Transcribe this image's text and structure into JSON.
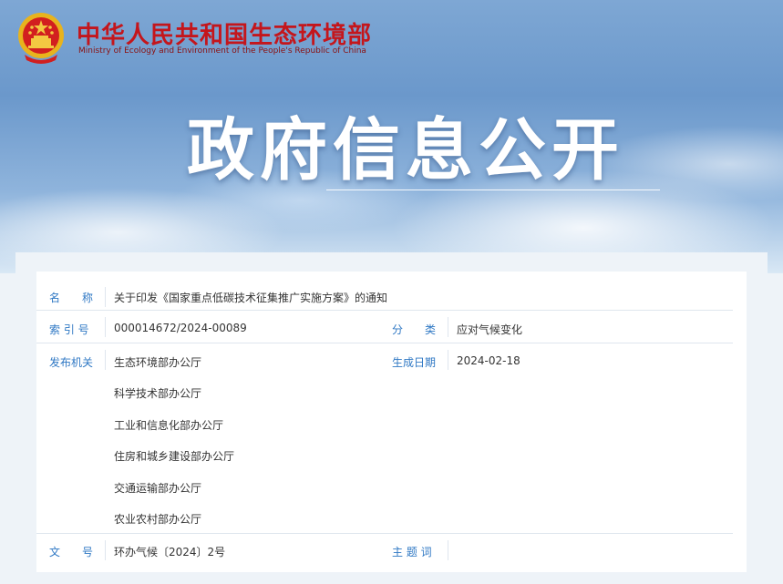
{
  "header": {
    "brand_cn": "中华人民共和国生态环境部",
    "brand_en": "Ministry of Ecology and Environment of the People's Republic of China",
    "hero_title": "政府信息公开"
  },
  "colors": {
    "brand_red": "#c4161c",
    "label_blue": "#2f78c4",
    "text": "#333333"
  },
  "info": {
    "name_label": "名　　称",
    "name_value": "关于印发《国家重点低碳技术征集推广实施方案》的通知",
    "index_label": "索 引 号",
    "index_value": "000014672/2024-00089",
    "category_label": "分　　类",
    "category_value": "应对气候变化",
    "issuer_label": "发布机关",
    "issuers": [
      "生态环境部办公厅",
      "科学技术部办公厅",
      "工业和信息化部办公厅",
      "住房和城乡建设部办公厅",
      "交通运输部办公厅",
      "农业农村部办公厅"
    ],
    "date_label": "生成日期",
    "date_value": "2024-02-18",
    "doc_no_label": "文　　号",
    "doc_no_value": "环办气候〔2024〕2号",
    "subject_label": "主 题 词",
    "subject_value": ""
  }
}
